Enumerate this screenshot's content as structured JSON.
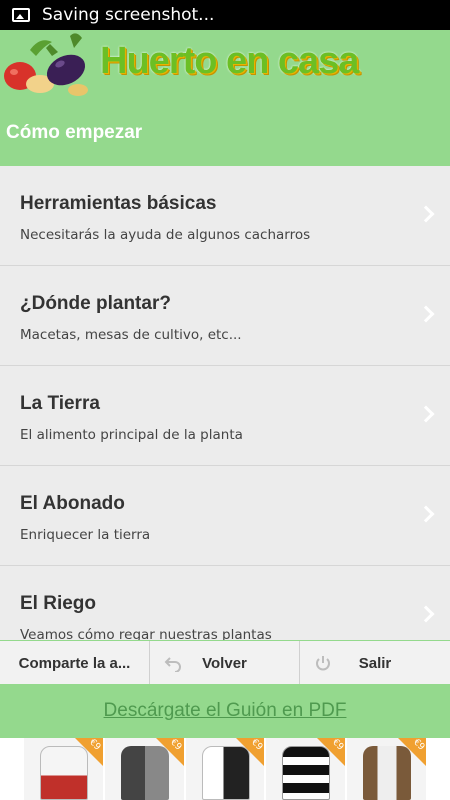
{
  "status_bar": {
    "text": "Saving screenshot..."
  },
  "header": {
    "app_title": "Huerto en casa",
    "section_title": "Cómo empezar"
  },
  "list": {
    "items": [
      {
        "title": "Herramientas básicas",
        "subtitle": "Necesitarás la ayuda de algunos cacharros"
      },
      {
        "title": "¿Dónde plantar?",
        "subtitle": "Macetas, mesas de cultivo, etc..."
      },
      {
        "title": "La Tierra",
        "subtitle": "El alimento principal de la planta"
      },
      {
        "title": "El Abonado",
        "subtitle": "Enriquecer la tierra"
      },
      {
        "title": "El Riego",
        "subtitle": "Veamos cómo regar nuestras plantas"
      }
    ]
  },
  "toolbar": {
    "share_label": "Comparte la a...",
    "back_label": "Volver",
    "exit_label": "Salir"
  },
  "pdf": {
    "link_text": "Descárgate el Guión en PDF"
  },
  "ad": {
    "tags": [
      "€9",
      "€9",
      "€9",
      "€9",
      "€9"
    ]
  },
  "colors": {
    "header_bg": "#94d98d",
    "title_green": "#6cbf24",
    "list_bg": "#ececec",
    "pdf_link": "#4f9a4f",
    "ad_tag": "#f0a030"
  }
}
